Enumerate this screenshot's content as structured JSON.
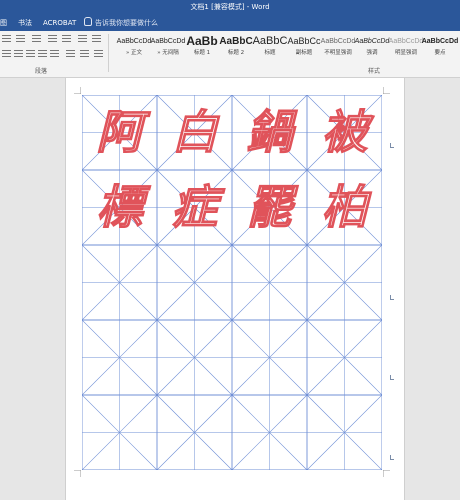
{
  "window": {
    "title": "文档1 [兼容模式] - Word"
  },
  "menu": {
    "items": [
      "图",
      "书法",
      "ACROBAT"
    ],
    "tell_me": "告诉我你想要做什么"
  },
  "ribbon": {
    "paragraph_group_label": "段落",
    "styles_group_label": "样式",
    "styles": [
      {
        "preview": "AaBbCcDd",
        "name": "» 正文"
      },
      {
        "preview": "AaBbCcDd",
        "name": "» 无间隔"
      },
      {
        "preview": "AaBb",
        "name": "标题 1"
      },
      {
        "preview": "AaBbC",
        "name": "标题 2"
      },
      {
        "preview": "AaBbC",
        "name": "标题"
      },
      {
        "preview": "AaBbCc",
        "name": "副标题"
      },
      {
        "preview": "AaBbCcDd",
        "name": "不明显强调"
      },
      {
        "preview": "AaBbCcDd",
        "name": "强调"
      },
      {
        "preview": "AaBbCcDd",
        "name": "明显强调"
      },
      {
        "preview": "AaBbCcDd",
        "name": "要点"
      }
    ]
  },
  "document": {
    "characters": [
      "阿",
      "白",
      "鍋",
      "被",
      "標",
      "症",
      "罷",
      "柏"
    ],
    "colors": {
      "grid_line": "#6f8fd6",
      "char_outline": "#e0535a"
    }
  }
}
